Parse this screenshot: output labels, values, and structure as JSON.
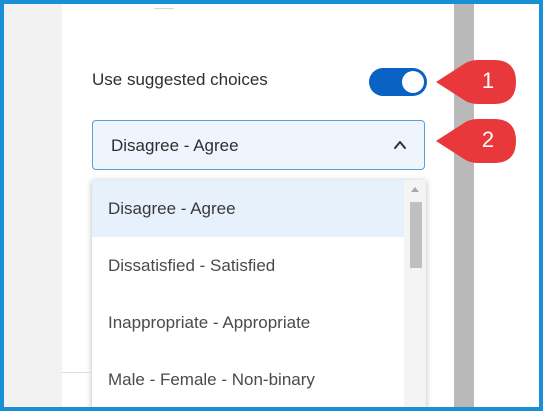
{
  "toggle": {
    "label": "Use suggested choices",
    "state": "on",
    "on_color": "#0a63c4"
  },
  "select": {
    "value": "Disagree - Agree",
    "expanded": true,
    "chevron_icon": "chevron-up-icon"
  },
  "dropdown": {
    "items": [
      "Disagree - Agree",
      "Dissatisfied - Satisfied",
      "Inappropriate - Appropriate",
      "Male - Female - Non-binary"
    ],
    "selected_index": 0
  },
  "callouts": [
    {
      "number": "1",
      "color": "#e8383b"
    },
    {
      "number": "2",
      "color": "#e8383b"
    }
  ],
  "colors": {
    "frame_border": "#1a8fd6",
    "select_border": "#5a9fd6",
    "selected_item_bg": "#e6f1fb"
  }
}
